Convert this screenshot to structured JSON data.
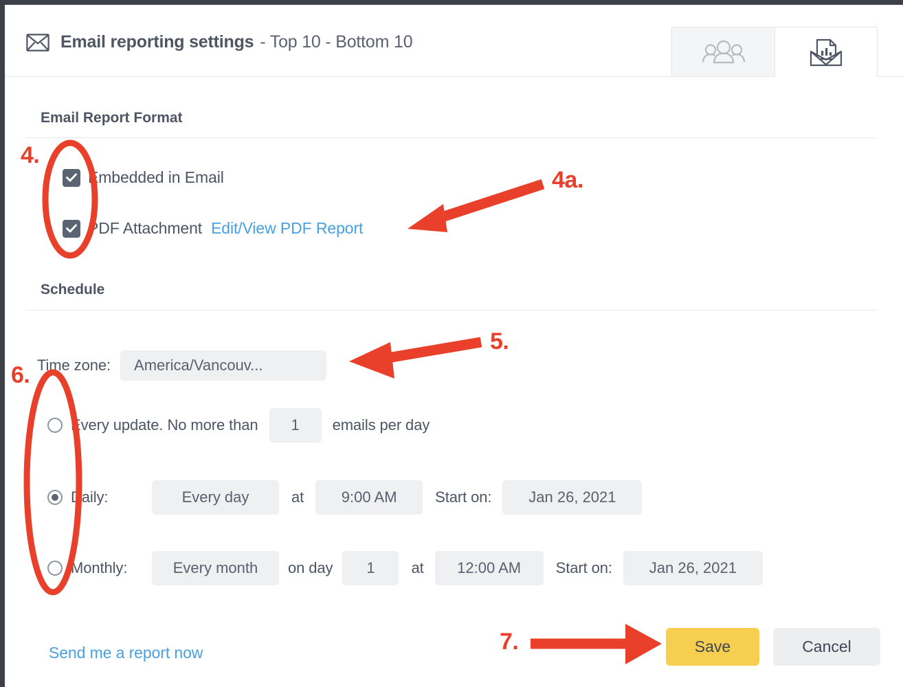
{
  "header": {
    "icon": "envelope-icon",
    "title": "Email reporting settings",
    "subtitle": "- Top 10 - Bottom 10",
    "tabs": [
      {
        "name": "recipients-tab",
        "icon": "people-group-icon",
        "active": false
      },
      {
        "name": "report-settings-tab",
        "icon": "email-report-icon",
        "active": true
      }
    ]
  },
  "format_section": {
    "heading": "Email Report Format",
    "options": [
      {
        "label": "Embedded in Email",
        "checked": true
      },
      {
        "label": "PDF Attachment",
        "checked": true
      }
    ],
    "pdf_link": "Edit/View PDF Report"
  },
  "schedule_section": {
    "heading": "Schedule",
    "timezone_label": "Time zone:",
    "timezone_value": "America/Vancouv...",
    "every_update": {
      "selected": false,
      "label_before": "Every update.  No more than",
      "count": "1",
      "label_after": "emails per day"
    },
    "daily": {
      "selected": true,
      "label": "Daily:",
      "frequency": "Every day",
      "at_label": "at",
      "time": "9:00 AM",
      "start_label": "Start on:",
      "start_date": "Jan 26, 2021"
    },
    "monthly": {
      "selected": false,
      "label": "Monthly:",
      "frequency": "Every month",
      "on_day_label": "on day",
      "day": "1",
      "at_label": "at",
      "time": "12:00 AM",
      "start_label": "Start on:",
      "start_date": "Jan 26, 2021"
    }
  },
  "footer": {
    "send_now_link": "Send me a report now",
    "save_label": "Save",
    "cancel_label": "Cancel"
  },
  "annotations": {
    "color": "#e8402a",
    "step4": "4.",
    "step4a": "4a.",
    "step5": "5.",
    "step6": "6.",
    "step7": "7."
  },
  "colors": {
    "accent_yellow": "#f6ce50",
    "link_blue": "#48a0e0",
    "text_slate": "#4b5563",
    "field_gray": "#eef0f1",
    "annotation_red": "#e8402a"
  }
}
